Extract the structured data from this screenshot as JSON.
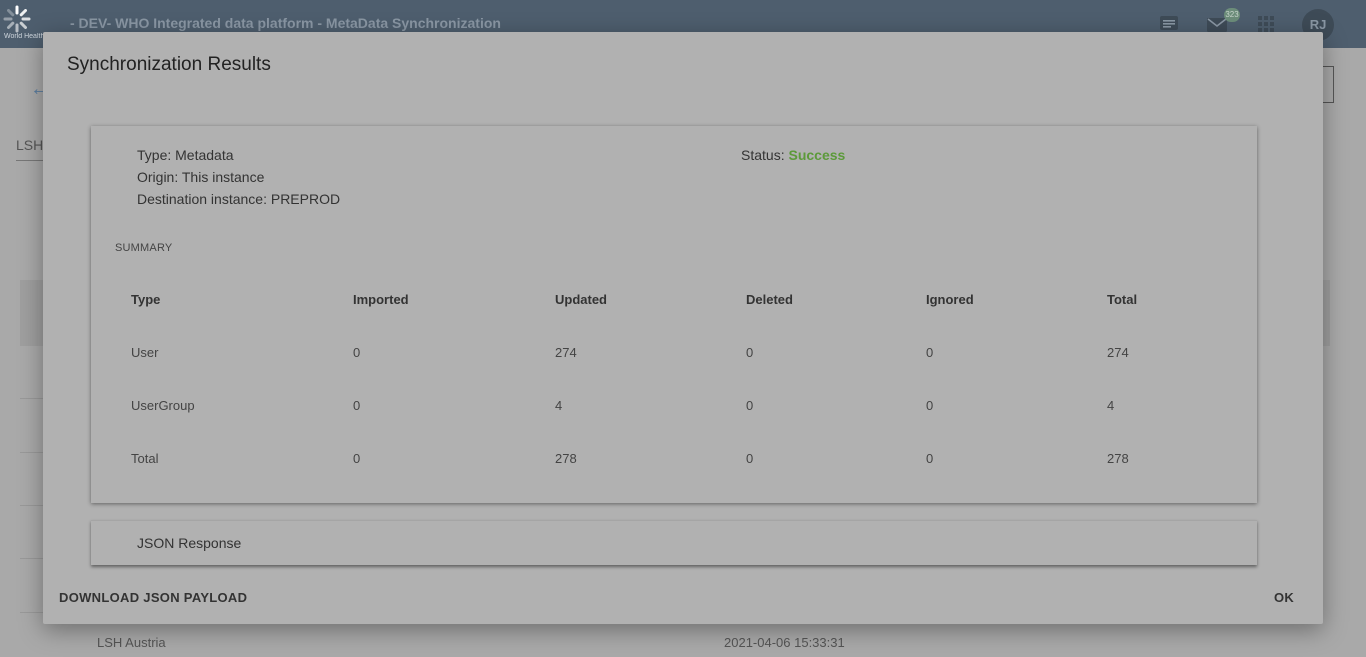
{
  "header": {
    "logo_text": "World Health Organization",
    "title": "- DEV- WHO Integrated data platform - MetaData Synchronization",
    "messages_badge": "323",
    "user_initials": "RJ",
    "icons": [
      "chat-icon",
      "mail-icon",
      "apps-grid-icon"
    ]
  },
  "background": {
    "filter_label": "LSH",
    "row": {
      "name": "LSH Austria",
      "timestamp": "2021-04-06 15:33:31"
    }
  },
  "dialog": {
    "title": "Synchronization Results",
    "type_line": "Type: Metadata",
    "origin_line": "Origin: This instance",
    "destination_line": "Destination instance: PREPROD",
    "status_label": "Status:",
    "status_value": "Success",
    "summary_label": "SUMMARY",
    "table": {
      "columns": [
        "Type",
        "Imported",
        "Updated",
        "Deleted",
        "Ignored",
        "Total"
      ],
      "rows": [
        [
          "User",
          "0",
          "274",
          "0",
          "0",
          "274"
        ],
        [
          "UserGroup",
          "0",
          "4",
          "0",
          "0",
          "4"
        ],
        [
          "Total",
          "0",
          "278",
          "0",
          "0",
          "278"
        ]
      ]
    },
    "json_panel_label": "JSON Response",
    "download_button": "DOWNLOAD JSON PAYLOAD",
    "ok_button": "OK"
  },
  "colors": {
    "status_success": "#5c9a3a",
    "header_bg": "#4e5e6e"
  }
}
